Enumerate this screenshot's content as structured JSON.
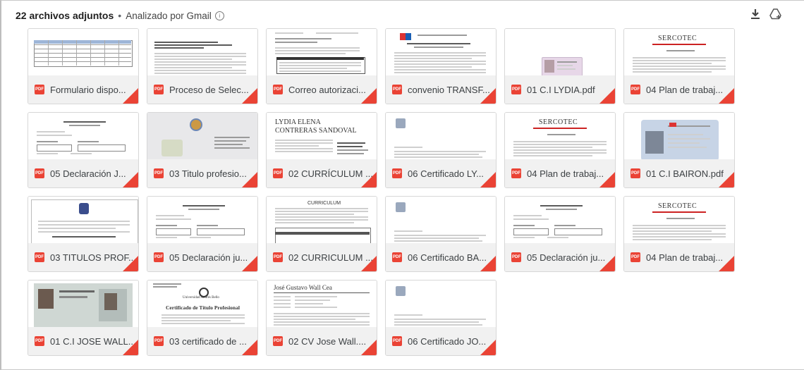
{
  "header": {
    "count_label": "22 archivos adjuntos",
    "separator": "•",
    "analyzed_label": "Analizado por Gmail",
    "info_glyph": "i"
  },
  "actions": {
    "download_icon": "download-icon",
    "drive_icon": "add-to-drive-icon"
  },
  "file_type_label": "PDF",
  "thumbnail_text": {
    "lydia_name_1": "LYDIA ELENA",
    "lydia_name_2": "CONTRERAS SANDOVAL",
    "jose_name": "José Gustavo Wall Cea",
    "university": "Universidad Andrés Bello",
    "certificate_title": "Certificado de Título Profesional",
    "sercotec": "SERCOTEC",
    "curriculum": "CURRICULUM"
  },
  "attachments": [
    {
      "name": "Formulario dispo...",
      "thumb": "table"
    },
    {
      "name": "Proceso de Selec...",
      "thumb": "text"
    },
    {
      "name": "Correo autorizaci...",
      "thumb": "email"
    },
    {
      "name": "convenio TRANSF...",
      "thumb": "convenio"
    },
    {
      "name": "01 C.I LYDIA.pdf",
      "thumb": "id"
    },
    {
      "name": "04 Plan de trabaj...",
      "thumb": "sercotec"
    },
    {
      "name": "05 Declaración J...",
      "thumb": "decl"
    },
    {
      "name": "03 Titulo profesio...",
      "thumb": "titlephoto"
    },
    {
      "name": "02 CURRÍCULUM ...",
      "thumb": "cvlydia"
    },
    {
      "name": "06 Certificado LY...",
      "thumb": "cert"
    },
    {
      "name": "04 Plan de trabaj...",
      "thumb": "sercotec"
    },
    {
      "name": "01 C.I BAIRON.pdf",
      "thumb": "idcard"
    },
    {
      "name": "03 TITULOS PROF...",
      "thumb": "titulos"
    },
    {
      "name": "05 Declaración ju...",
      "thumb": "decl"
    },
    {
      "name": "02 CURRICULUM ...",
      "thumb": "curriculum"
    },
    {
      "name": "06 Certificado BA...",
      "thumb": "cert"
    },
    {
      "name": "05 Declaración ju...",
      "thumb": "decl"
    },
    {
      "name": "04 Plan de trabaj...",
      "thumb": "sercotec"
    },
    {
      "name": "01 C.I JOSE WALL...",
      "thumb": "idscan"
    },
    {
      "name": "03 certificado de ...",
      "thumb": "unab"
    },
    {
      "name": "02 CV Jose Wall....",
      "thumb": "cvjose"
    },
    {
      "name": "06 Certificado JO...",
      "thumb": "cert"
    }
  ]
}
